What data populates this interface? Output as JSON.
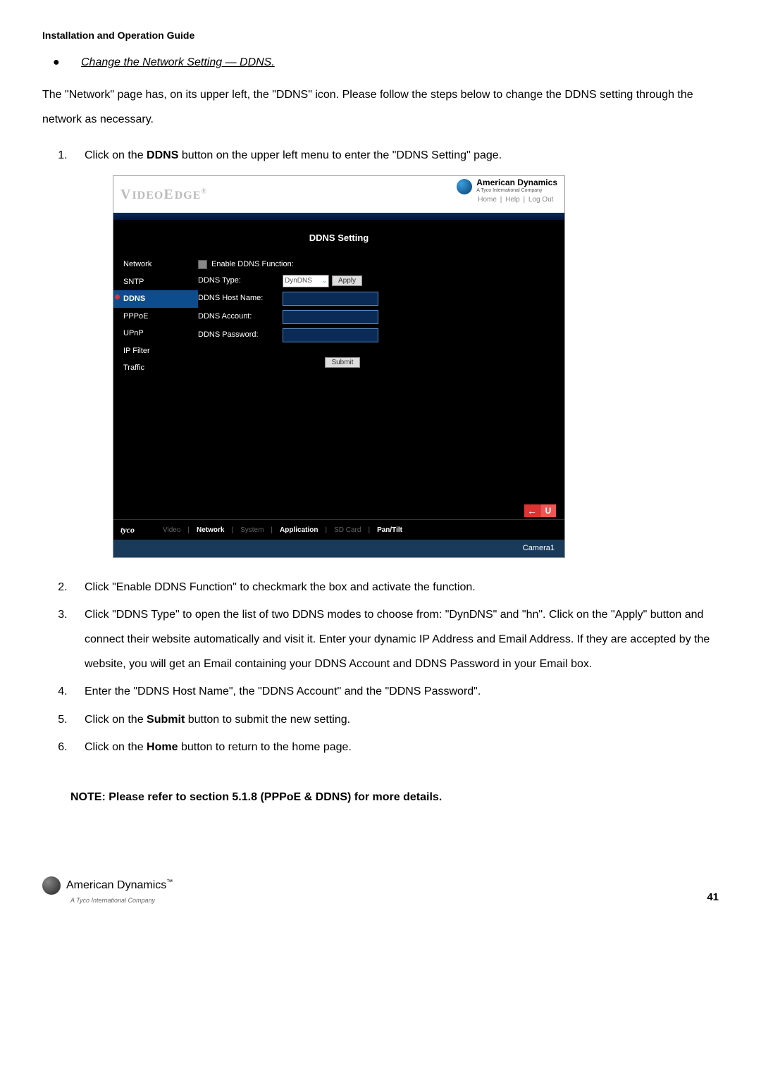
{
  "guide_title": "Installation and Operation Guide",
  "section_heading": "Change the Network Setting — DDNS.",
  "intro": "The \"Network\" page has, on its upper left, the \"DDNS\" icon. Please follow the steps below to change the DDNS setting through the network as necessary.",
  "steps": {
    "s1_pre": "Click on the ",
    "s1_bold": "DDNS",
    "s1_post": " button on the upper left menu to enter the \"DDNS Setting\" page.",
    "s2": "Click \"Enable DDNS Function\" to checkmark the box and activate the function.",
    "s3": "Click \"DDNS Type\" to open the list of two DDNS modes to choose from: \"DynDNS\" and \"hn\". Click on the \"Apply\" button and connect their website automatically and visit it. Enter your dynamic IP Address and Email Address. If they are accepted by the website, you will get an Email containing your DDNS Account and DDNS Password in your Email box.",
    "s4": "Enter the \"DDNS Host Name\", the \"DDNS Account\" and the \"DDNS Password\".",
    "s5_pre": "Click on the ",
    "s5_bold": "Submit",
    "s5_post": " button to submit the new setting.",
    "s6_pre": "Click on the ",
    "s6_bold": "Home",
    "s6_post": " button to return to the home page."
  },
  "note": "NOTE: Please refer to section 5.1.8 (PPPoE & DDNS) for more details.",
  "app": {
    "logo": "VIDEOEDGE",
    "logo_reg": "®",
    "brand": "American Dynamics",
    "brand_sub": "A Tyco International Company",
    "links": {
      "home": "Home",
      "help": "Help",
      "logout": "Log Out"
    },
    "page_title": "DDNS Setting",
    "sidebar": [
      "Network",
      "SNTP",
      "DDNS",
      "PPPoE",
      "UPnP",
      "IP Filter",
      "Traffic"
    ],
    "form": {
      "enable_label": "Enable DDNS Function:",
      "type_label": "DDNS Type:",
      "type_value": "DynDNS",
      "apply": "Apply",
      "host_label": "DDNS Host Name:",
      "acct_label": "DDNS Account:",
      "pass_label": "DDNS Password:",
      "submit": "Submit"
    },
    "footer": {
      "tyco": "tyco",
      "tabs": [
        "Video",
        "Network",
        "System",
        "Application",
        "SD Card",
        "Pan/Tilt"
      ],
      "arrow": "←",
      "u": "U",
      "camera": "Camera1"
    }
  },
  "page_footer": {
    "brand": "American Dynamics",
    "tm": "™",
    "sub": "A Tyco International Company",
    "page": "41"
  }
}
